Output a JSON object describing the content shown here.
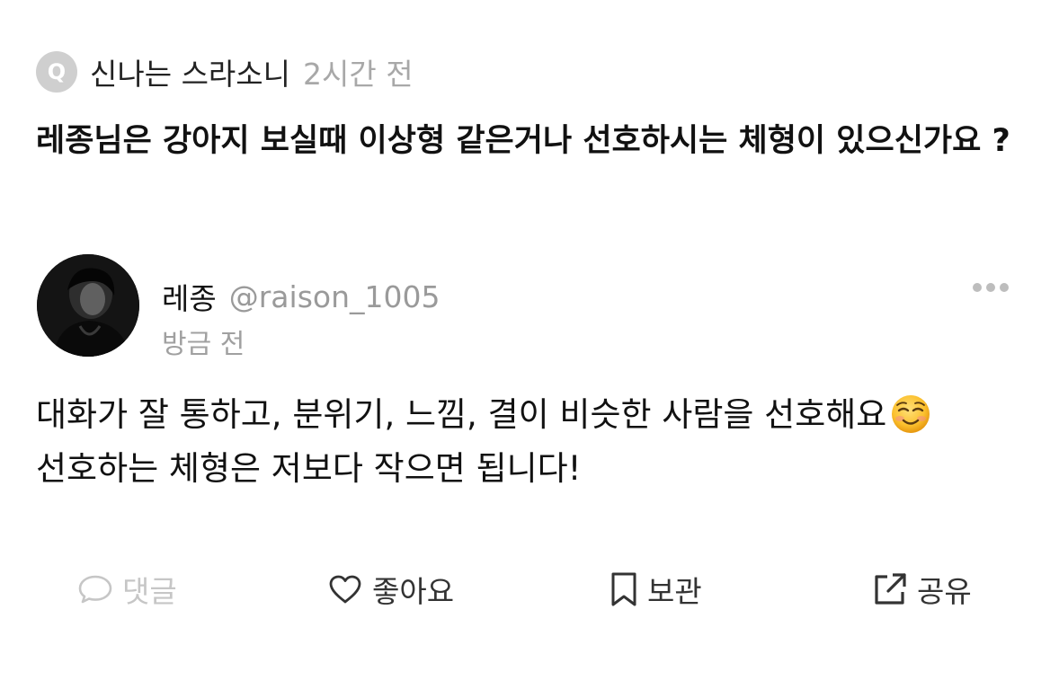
{
  "asker": {
    "badge": "Q",
    "name": "신나는 스라소니",
    "time": "2시간 전"
  },
  "question": {
    "text": "레종님은 강아지 보실때 이상형 같은거나 선호하시는 체형이 있으신가요 ?"
  },
  "answer": {
    "author_name": "레종",
    "author_handle": "@raison_1005",
    "time": "방금 전",
    "line1": "대화가 잘 통하고, 분위기, 느낌, 결이 비슷한 사람을 선호해요",
    "line2": "선호하는 체형은 저보다 작으면 됩니다!",
    "emoji": "smiling-face-icon"
  },
  "actions": {
    "comment": "댓글",
    "like": "좋아요",
    "save": "보관",
    "share": "공유"
  },
  "colors": {
    "muted": "#a8a8a8",
    "disabled": "#c6c6c6",
    "text": "#111111",
    "badge": "#cfcfcf"
  }
}
